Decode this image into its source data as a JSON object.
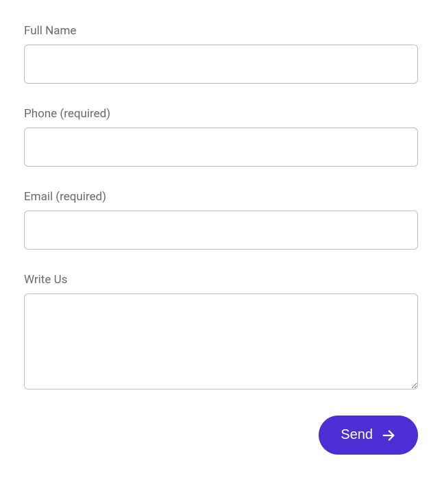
{
  "form": {
    "fullname": {
      "label": "Full Name",
      "value": ""
    },
    "phone": {
      "label": "Phone (required)",
      "value": ""
    },
    "email": {
      "label": "Email (required)",
      "value": ""
    },
    "message": {
      "label": "Write Us",
      "value": ""
    },
    "submit_label": "Send"
  }
}
